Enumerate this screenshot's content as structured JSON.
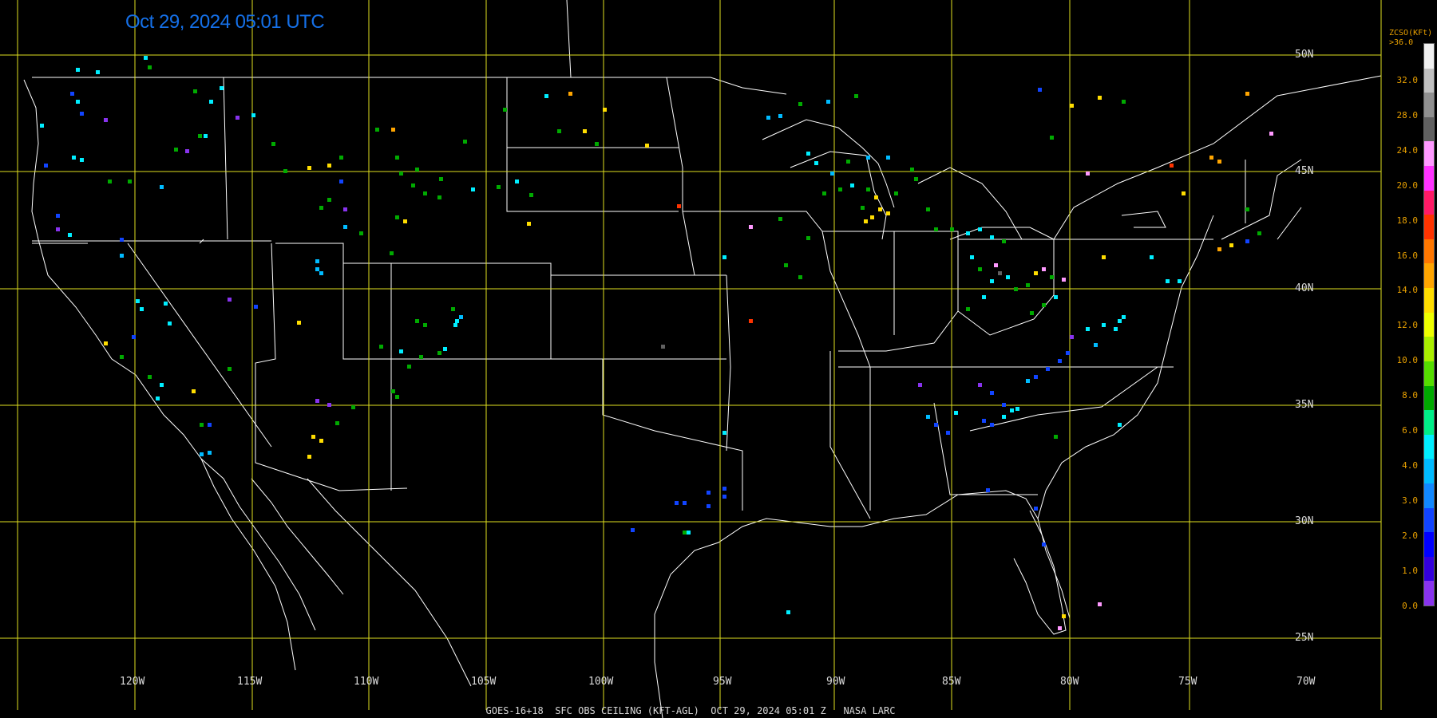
{
  "timestamp": "Oct 29, 2024 05:01 UTC",
  "footer": "GOES-16+18  SFC OBS CEILING (KFT-AGL)  OCT 29, 2024 05:01 Z   NASA LARC",
  "grid": {
    "lon_labels": [
      "120W",
      "115W",
      "110W",
      "105W",
      "100W",
      "95W",
      "90W",
      "85W",
      "80W",
      "75W",
      "70W"
    ],
    "lat_labels": [
      "50N",
      "45N",
      "40N",
      "35N",
      "30N",
      "25N"
    ],
    "line_color": "#e0e020"
  },
  "legend": {
    "title": [
      "ZCSO(KFt)",
      ">36.0"
    ],
    "labels": [
      "32.0",
      "28.0",
      "24.0",
      "20.0",
      "18.0",
      "16.0",
      "14.0",
      "12.0",
      "10.0",
      "8.0",
      "6.0",
      "4.0",
      "3.0",
      "2.0",
      "1.0",
      "0.0"
    ],
    "colors": [
      "#f0f0f0",
      "#c0c0c0",
      "#909090",
      "#606060",
      "#ff99ff",
      "#ff33ff",
      "#ff1a66",
      "#ff3300",
      "#ff7700",
      "#ffa500",
      "#ffdd00",
      "#eeff00",
      "#aaee00",
      "#55dd00",
      "#00aa00",
      "#00ee88",
      "#00eeff",
      "#00bbff",
      "#1188ff",
      "#1144ff",
      "#0000ff",
      "#3300dd",
      "#8833ee"
    ],
    "label_color": "#e8a000"
  },
  "map_colors": {
    "background": "#000000",
    "borders": "#ffffff"
  }
}
